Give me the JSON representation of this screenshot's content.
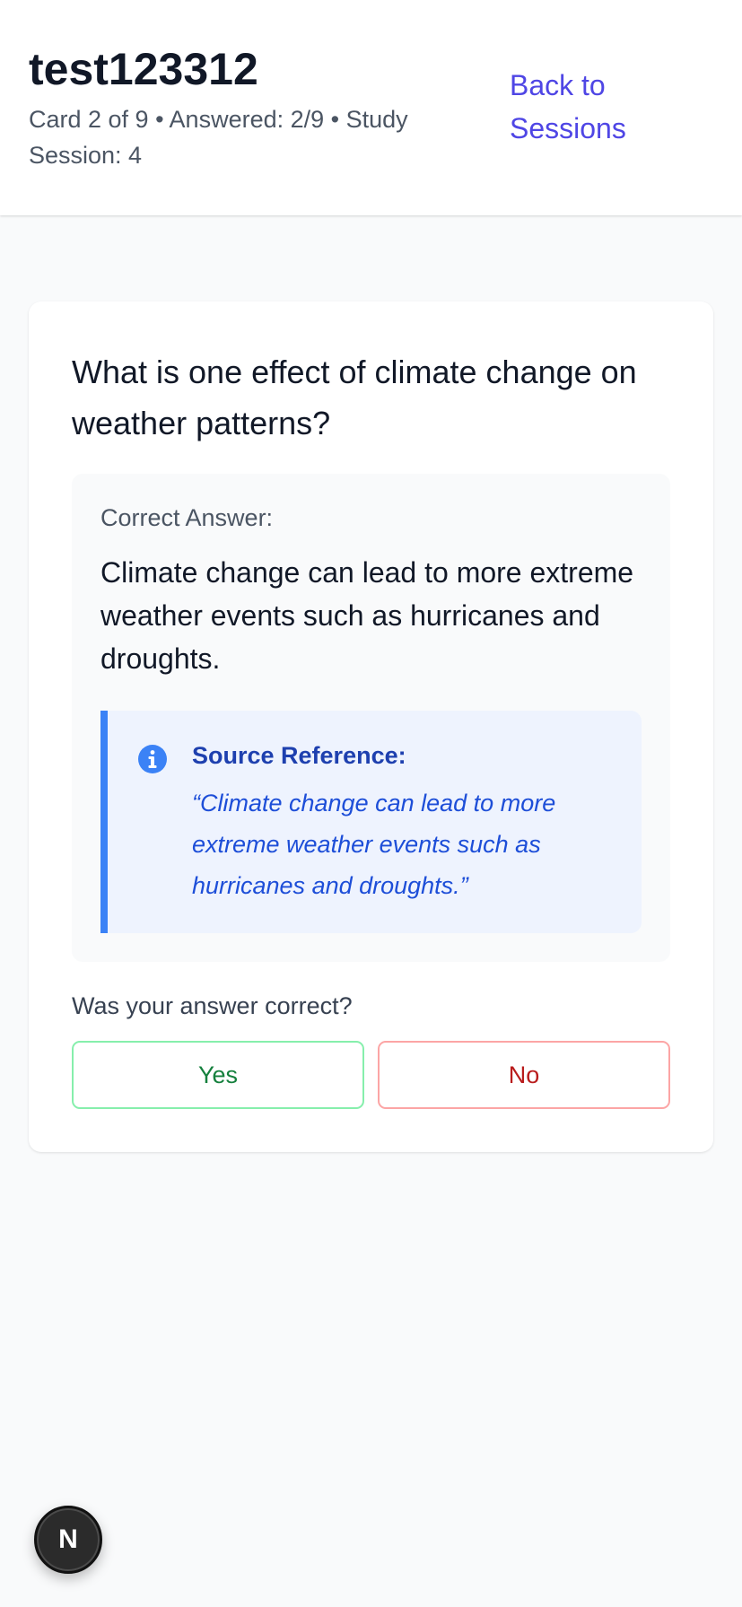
{
  "header": {
    "title": "test123312",
    "subtitle": "Card 2 of 9 • Answered: 2/9 • Study Session: 4",
    "back_link": "Back to Sessions"
  },
  "card": {
    "question": "What is one effect of climate change on weather patterns?",
    "answer_label": "Correct Answer:",
    "answer_text": "Climate change can lead to more extreme weather events such as hurricanes and droughts.",
    "source": {
      "icon": "info-icon",
      "title": "Source Reference:",
      "quote": "“Climate change can lead to more extreme weather events such as hurricanes and droughts.”"
    },
    "prompt": "Was your answer correct?",
    "yes_label": "Yes",
    "no_label": "No"
  },
  "dev_badge": {
    "letter": "N"
  },
  "colors": {
    "accent": "#4f46e5",
    "source_border": "#3b82f6",
    "yes": "#15803d",
    "no": "#b91c1c"
  }
}
